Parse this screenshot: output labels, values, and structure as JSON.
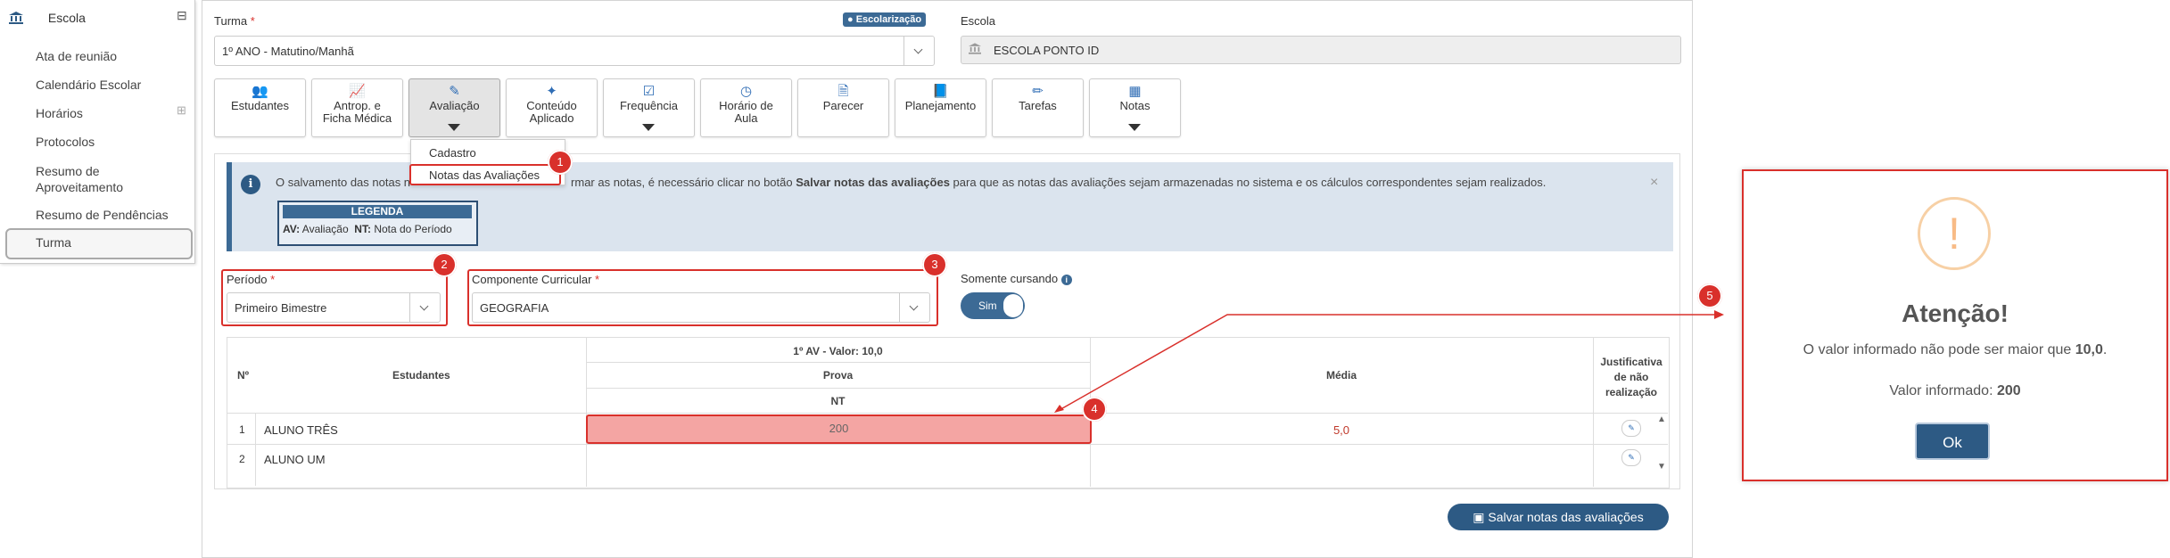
{
  "sidebar": {
    "header": "Escola",
    "collapse_symbol": "⊟",
    "expand_symbol": "⊞",
    "items": [
      {
        "label": "Ata de reunião"
      },
      {
        "label": "Calendário Escolar"
      },
      {
        "label": "Horários"
      },
      {
        "label": "Protocolos"
      },
      {
        "label": "Resumo de Aproveitamento"
      },
      {
        "label": "Resumo de Pendências"
      },
      {
        "label": "Turma"
      }
    ]
  },
  "form": {
    "turma_label": "Turma",
    "turma_value": "1º ANO - Matutino/Manhã",
    "badge": "Escolarização",
    "escola_label": "Escola",
    "escola_value": "ESCOLA PONTO ID",
    "required_mark": "*"
  },
  "toolbar": [
    {
      "label": "Estudantes",
      "icon": "users-icon"
    },
    {
      "label": "Antrop. e Ficha Médica",
      "icon": "chart-icon"
    },
    {
      "label": "Avaliação",
      "icon": "edit-icon"
    },
    {
      "label": "Conteúdo Aplicado",
      "icon": "magic-icon"
    },
    {
      "label": "Frequência",
      "icon": "check-icon"
    },
    {
      "label": "Horário de Aula",
      "icon": "clock-icon"
    },
    {
      "label": "Parecer",
      "icon": "file-icon"
    },
    {
      "label": "Planejamento",
      "icon": "book-icon"
    },
    {
      "label": "Tarefas",
      "icon": "pencil-icon"
    },
    {
      "label": "Notas",
      "icon": "table-icon"
    }
  ],
  "dropdown": {
    "items": [
      "Cadastro",
      "Notas das Avaliações"
    ]
  },
  "alert": {
    "text_before": "O salvamento das notas n",
    "text_after": "rmar as notas, é necessário clicar no botão ",
    "bold": "Salvar notas das avaliações",
    "text_end": " para que as notas das avaliações sejam armazenadas no sistema e os cálculos correspondentes sejam realizados.",
    "close": "×",
    "legend_title": "LEGENDA",
    "legend_av": "AV:",
    "legend_av_text": "Avaliação",
    "legend_nt": "NT:",
    "legend_nt_text": "Nota do Período"
  },
  "filters": {
    "periodo_label": "Período",
    "periodo_value": "Primeiro Bimestre",
    "componente_label": "Componente Curricular",
    "componente_value": "GEOGRAFIA",
    "somente_label": "Somente cursando",
    "toggle_label": "Sim"
  },
  "table": {
    "col_n": "Nº",
    "col_estudantes": "Estudantes",
    "av_header": "1º AV - Valor: 10,0",
    "prova": "Prova",
    "nt": "NT",
    "media": "Média",
    "justificativa": "Justificativa de não realização",
    "rows": [
      {
        "n": "1",
        "name": "ALUNO TRÊS",
        "value": "200",
        "media": "5,0"
      },
      {
        "n": "2",
        "name": "ALUNO UM",
        "value": "",
        "media": ""
      }
    ]
  },
  "save_button": "Salvar notas das avaliações",
  "callouts": [
    "1",
    "2",
    "3",
    "4",
    "5"
  ],
  "modal": {
    "icon": "!",
    "title": "Atenção!",
    "message_before": "O valor informado não pode ser maior que ",
    "message_bold": "10,0",
    "message_after": ".",
    "valor_label": "Valor informado: ",
    "valor_value": "200",
    "ok": "Ok"
  },
  "colors": {
    "accent": "#3c6a95",
    "highlight": "#d9302b",
    "error_cell": "#f4a5a3"
  }
}
